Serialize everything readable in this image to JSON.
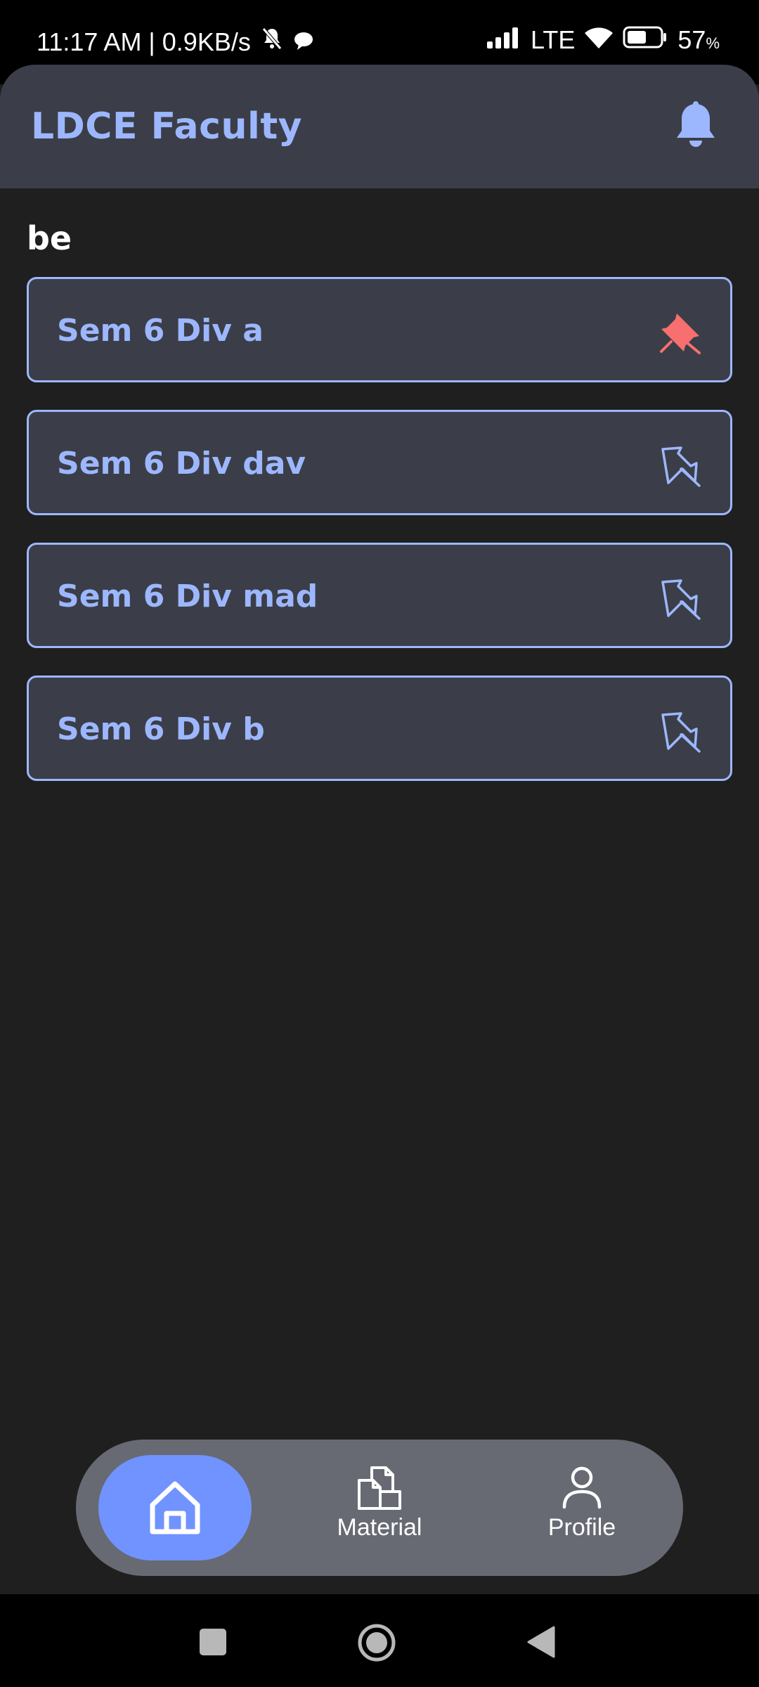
{
  "status_bar": {
    "time_speed": "11:17 AM | 0.9KB/s",
    "network": "LTE",
    "battery": "57",
    "battery_unit": "%"
  },
  "header": {
    "title": "LDCE Faculty"
  },
  "section": {
    "title": "be"
  },
  "divisions": [
    {
      "label": "Sem 6 Div a",
      "pinned": true
    },
    {
      "label": "Sem 6 Div dav",
      "pinned": false
    },
    {
      "label": "Sem 6 Div mad",
      "pinned": false
    },
    {
      "label": "Sem 6 Div b",
      "pinned": false
    }
  ],
  "bottom_nav": {
    "home_icon": "home-icon",
    "material_label": "Material",
    "profile_label": "Profile",
    "selected": "home"
  },
  "colors": {
    "accent": "#9db7ff",
    "pinned": "#f76f6f",
    "nav_selected": "#7193ff",
    "card_bg": "#3b3e48",
    "page_bg": "#1f1f1f"
  }
}
